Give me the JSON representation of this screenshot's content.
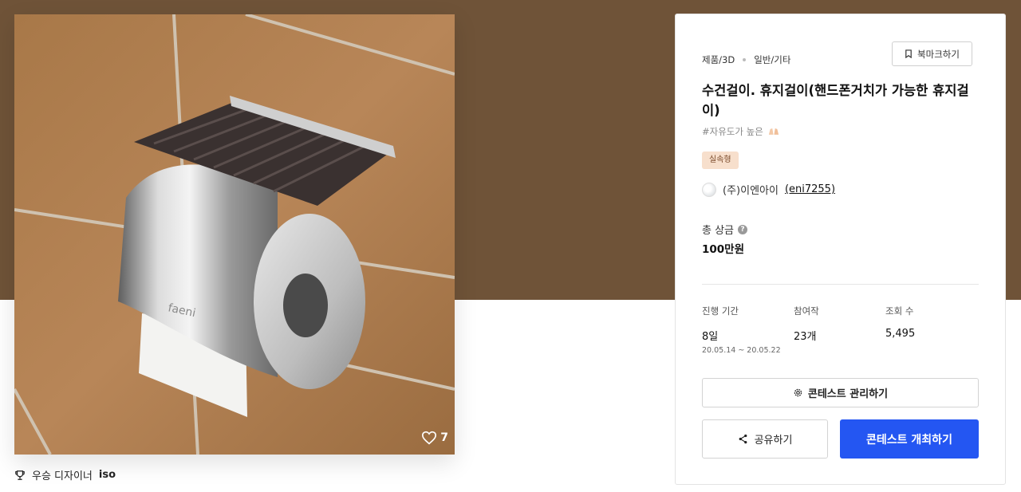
{
  "colors": {
    "hero_background": "#6f5338",
    "primary_button": "#2456f2",
    "type_badge_bg": "#f7dfcc"
  },
  "image": {
    "likes": "7",
    "icons": {
      "like": "heart-outline-icon"
    }
  },
  "winner": {
    "label": "우승 디자이너",
    "name": "iso",
    "icon": "trophy-icon"
  },
  "contest": {
    "category": "제품/3D",
    "subcategory": "일반/기타",
    "bookmark_label": "북마크하기",
    "title": "수건걸이. 휴지걸이(핸드폰거치가 가능한 휴지걸이)",
    "tagline": "#자유도가 높은",
    "type_badge": "실속형",
    "host_name": "(주)이엔아이",
    "host_handle": "(eni7255)",
    "prize_label": "총 상금",
    "prize_value": "100만원",
    "stats": {
      "duration_label": "진행 기간",
      "duration_value": "8일",
      "duration_range": "20.05.14 ~ 20.05.22",
      "participants_label": "참여작",
      "participants_value": "23개",
      "views_label": "조회 수",
      "views_value": "5,495"
    },
    "manage_label": "콘테스트 관리하기",
    "share_label": "공유하기",
    "host_contest_label": "콘테스트 개최하기"
  }
}
